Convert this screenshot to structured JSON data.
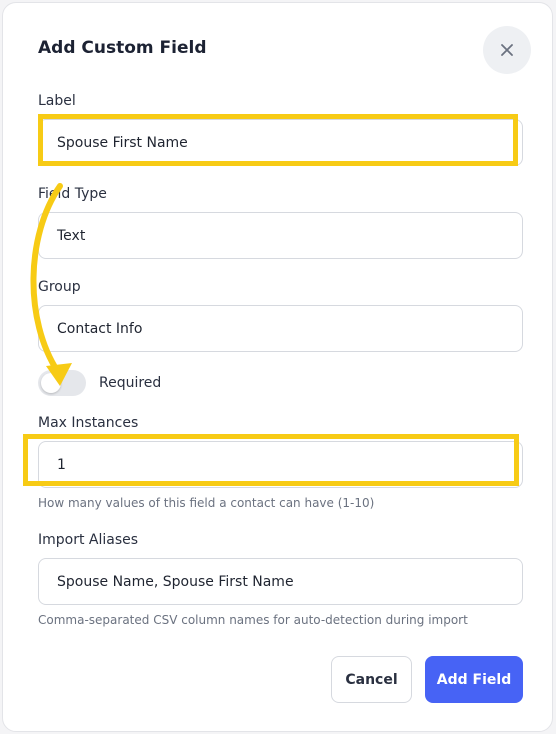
{
  "dialog": {
    "title": "Add Custom Field",
    "close_icon": "close-icon"
  },
  "fields": {
    "label": {
      "label": "Label",
      "value": "Spouse First Name"
    },
    "field_type": {
      "label": "Field Type",
      "value": "Text"
    },
    "group": {
      "label": "Group",
      "value": "Contact Info"
    },
    "required": {
      "label": "Required",
      "checked": false
    },
    "max_instances": {
      "label": "Max Instances",
      "value": "1",
      "hint": "How many values of this field a contact can have (1-10)"
    },
    "import_aliases": {
      "label": "Import Aliases",
      "value": "Spouse Name, Spouse First Name",
      "hint": "Comma-separated CSV column names for auto-detection during import"
    }
  },
  "actions": {
    "cancel_label": "Cancel",
    "add_label": "Add Field"
  },
  "annotations": {
    "highlight_color": "#f7cb15",
    "arrow_icon": "curved-arrow-icon"
  },
  "colors": {
    "primary": "#4763f5"
  }
}
